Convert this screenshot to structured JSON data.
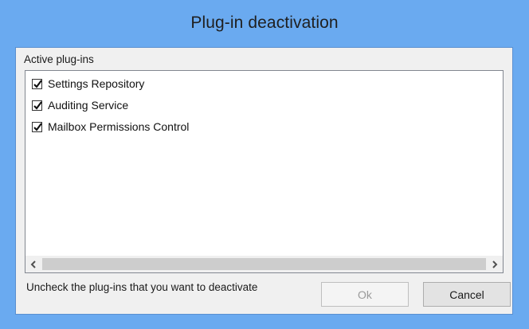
{
  "dialog": {
    "title": "Plug-in deactivation",
    "group_label": "Active plug-ins",
    "plugins": [
      {
        "label": "Settings Repository",
        "checked": true
      },
      {
        "label": "Auditing Service",
        "checked": true
      },
      {
        "label": "Mailbox Permissions Control",
        "checked": true
      }
    ],
    "hint_text": "Uncheck the plug-ins that you want to deactivate",
    "ok_label": "Ok",
    "cancel_label": "Cancel",
    "ok_enabled": false,
    "icons": {
      "scroll_left": "chevron-left-icon",
      "scroll_right": "chevron-right-icon",
      "check": "checkmark-icon"
    }
  }
}
